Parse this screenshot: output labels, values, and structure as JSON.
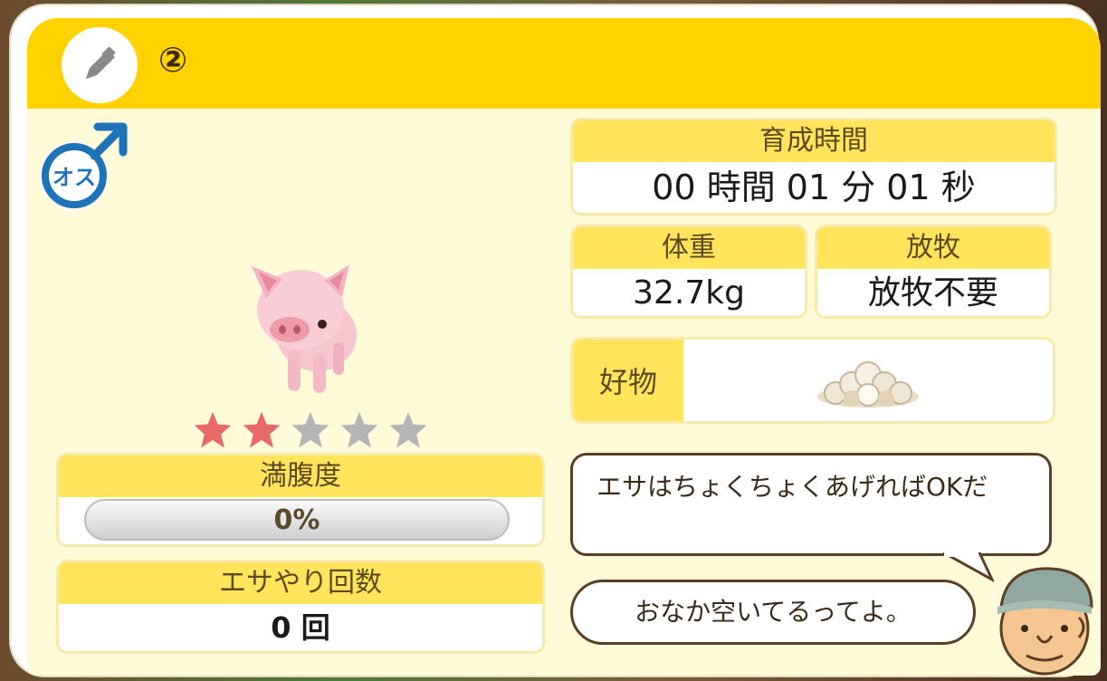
{
  "header": {
    "pig_number": "②",
    "edit_icon": "pencil-icon"
  },
  "gender": {
    "label": "オス",
    "icon": "male-symbol-icon"
  },
  "rating": {
    "filled": 2,
    "total": 5,
    "filled_color": "#e8696a",
    "empty_color": "#b5b5b5"
  },
  "fullness": {
    "label": "満腹度",
    "value": "0%",
    "level": 0
  },
  "feed_count": {
    "label": "エサやり回数",
    "value": "0 回"
  },
  "raising_time": {
    "label": "育成時間",
    "value": "00 時間 01 分 01 秒"
  },
  "weight": {
    "label": "体重",
    "value": "32.7kg"
  },
  "grazing": {
    "label": "放牧",
    "value": "放牧不要"
  },
  "favorite": {
    "label": "好物",
    "item_icon": "grain-pile-icon"
  },
  "messages": {
    "tip": "エサはちょくちょくあげればOKだ",
    "status": "おなか空いてるってよ。"
  },
  "colors": {
    "header": "#ffd200",
    "card_head": "#ffe45c",
    "panel_bg": "#fffbd9"
  }
}
